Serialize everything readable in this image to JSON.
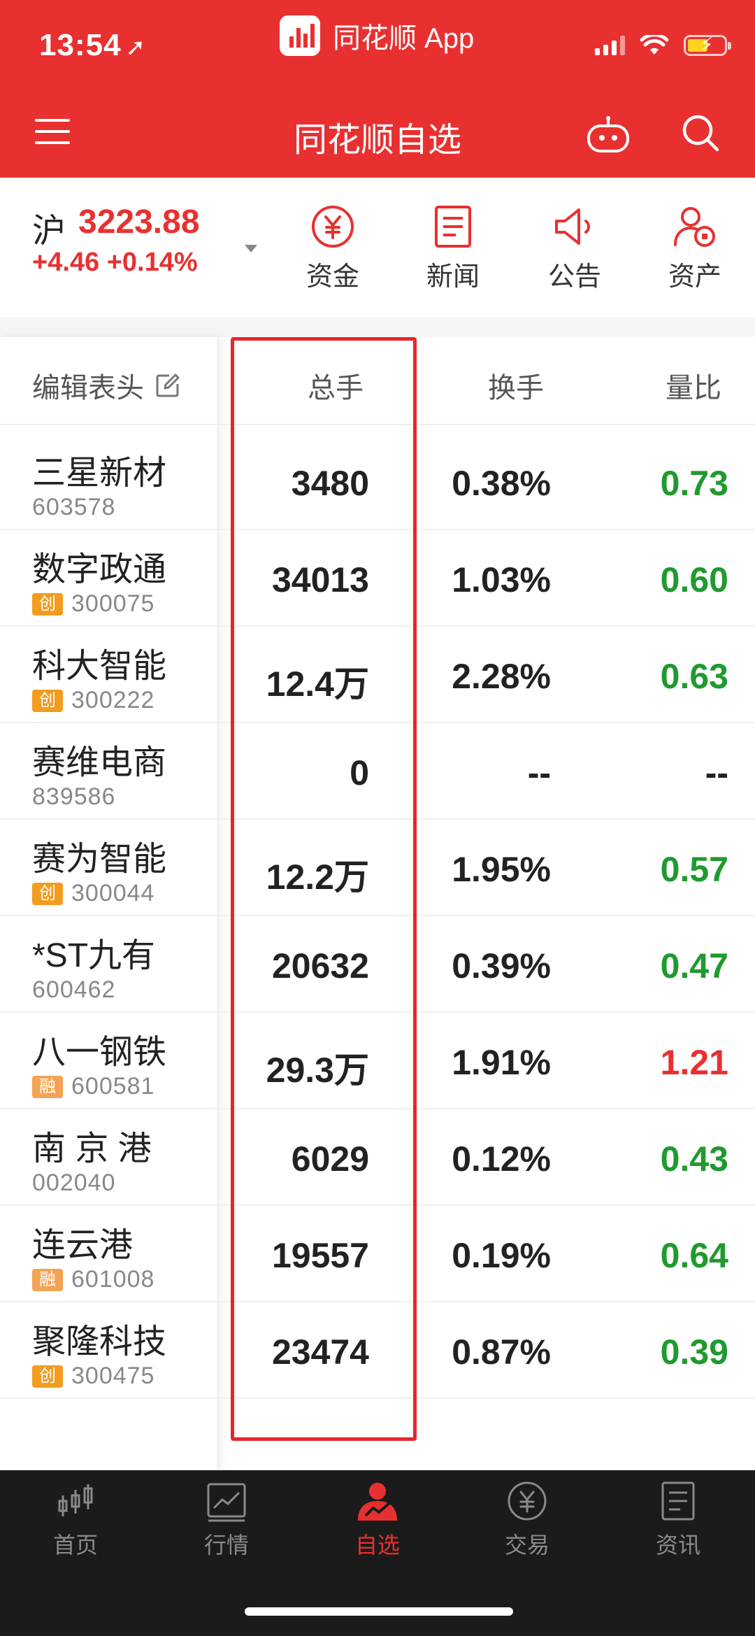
{
  "status_bar": {
    "time": "13:54",
    "app_label": "同花顺 App"
  },
  "header": {
    "title": "同花顺自选"
  },
  "index": {
    "market": "沪",
    "value": "3223.88",
    "change": "+4.46 +0.14%"
  },
  "quick_actions": [
    {
      "label": "资金",
      "icon": "yuan-circle-icon"
    },
    {
      "label": "新闻",
      "icon": "news-doc-icon"
    },
    {
      "label": "公告",
      "icon": "megaphone-icon"
    },
    {
      "label": "资产",
      "icon": "user-asset-icon"
    }
  ],
  "table": {
    "edit_label": "编辑表头",
    "columns": [
      "总手",
      "换手",
      "量比"
    ],
    "rows": [
      {
        "name": "三星新材",
        "code": "603578",
        "badge": "",
        "total": "3480",
        "turnover": "0.38%",
        "ratio": "0.73",
        "ratio_color": "#1f9a2f"
      },
      {
        "name": "数字政通",
        "code": "300075",
        "badge": "创",
        "total": "34013",
        "turnover": "1.03%",
        "ratio": "0.60",
        "ratio_color": "#1f9a2f"
      },
      {
        "name": "科大智能",
        "code": "300222",
        "badge": "创",
        "total": "12.4万",
        "turnover": "2.28%",
        "ratio": "0.63",
        "ratio_color": "#1f9a2f"
      },
      {
        "name": "赛维电商",
        "code": "839586",
        "badge": "",
        "total": "0",
        "turnover": "--",
        "ratio": "--",
        "ratio_color": "#222222"
      },
      {
        "name": "赛为智能",
        "code": "300044",
        "badge": "创",
        "total": "12.2万",
        "turnover": "1.95%",
        "ratio": "0.57",
        "ratio_color": "#1f9a2f"
      },
      {
        "name": "*ST九有",
        "code": "600462",
        "badge": "",
        "total": "20632",
        "turnover": "0.39%",
        "ratio": "0.47",
        "ratio_color": "#1f9a2f"
      },
      {
        "name": "八一钢铁",
        "code": "600581",
        "badge": "融",
        "total": "29.3万",
        "turnover": "1.91%",
        "ratio": "1.21",
        "ratio_color": "#e93030"
      },
      {
        "name": "南 京 港",
        "code": "002040",
        "badge": "",
        "total": "6029",
        "turnover": "0.12%",
        "ratio": "0.43",
        "ratio_color": "#1f9a2f"
      },
      {
        "name": "连云港",
        "code": "601008",
        "badge": "融",
        "total": "19557",
        "turnover": "0.19%",
        "ratio": "0.64",
        "ratio_color": "#1f9a2f"
      },
      {
        "name": "聚隆科技",
        "code": "300475",
        "badge": "创",
        "total": "23474",
        "turnover": "0.87%",
        "ratio": "0.39",
        "ratio_color": "#1f9a2f"
      }
    ]
  },
  "bottom_nav": [
    {
      "label": "首页",
      "icon": "candlestick-icon",
      "active": false
    },
    {
      "label": "行情",
      "icon": "chart-icon",
      "active": false
    },
    {
      "label": "自选",
      "icon": "watchlist-icon",
      "active": true
    },
    {
      "label": "交易",
      "icon": "yuan-circle-icon",
      "active": false
    },
    {
      "label": "资讯",
      "icon": "news-doc-icon",
      "active": false
    }
  ],
  "colors": {
    "brand_red": "#e93030",
    "down_green": "#1f9a2f",
    "highlight_box": "#e8262a"
  }
}
